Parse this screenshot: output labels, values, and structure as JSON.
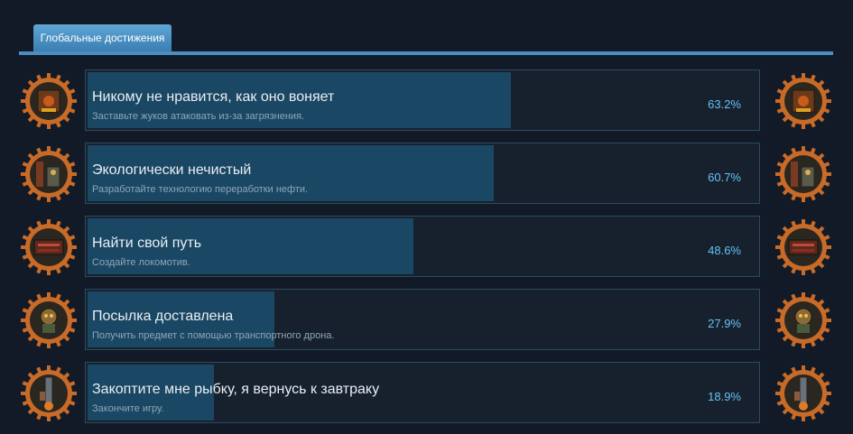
{
  "tab": {
    "label": "Глобальные достижения"
  },
  "achievements": [
    {
      "name": "Никому не нравится, как оно воняет",
      "description": "Заставьте жуков атаковать из-за загрязнения.",
      "percent_label": "63.2%",
      "percent": 63.2,
      "icon": "polluted-biters-icon"
    },
    {
      "name": "Экологически нечистый",
      "description": "Разработайте технологию переработки нефти.",
      "percent_label": "60.7%",
      "percent": 60.7,
      "icon": "oil-refinery-icon"
    },
    {
      "name": "Найти свой путь",
      "description": "Создайте локомотив.",
      "percent_label": "48.6%",
      "percent": 48.6,
      "icon": "locomotive-icon"
    },
    {
      "name": "Посылка доставлена",
      "description": "Получить предмет с помощью транспортного дрона.",
      "percent_label": "27.9%",
      "percent": 27.9,
      "icon": "logistic-robot-icon"
    },
    {
      "name": "Закоптите мне рыбку, я вернусь к завтраку",
      "description": "Закончите игру.",
      "percent_label": "18.9%",
      "percent": 18.9,
      "icon": "rocket-launch-icon"
    }
  ],
  "colors": {
    "background": "#111a26",
    "panel_border": "#2c4a60",
    "bar_fill": "#1a4763",
    "percent_text": "#66c0f4",
    "tab_active": "#4b8dc0",
    "gear": "#c86a28"
  }
}
